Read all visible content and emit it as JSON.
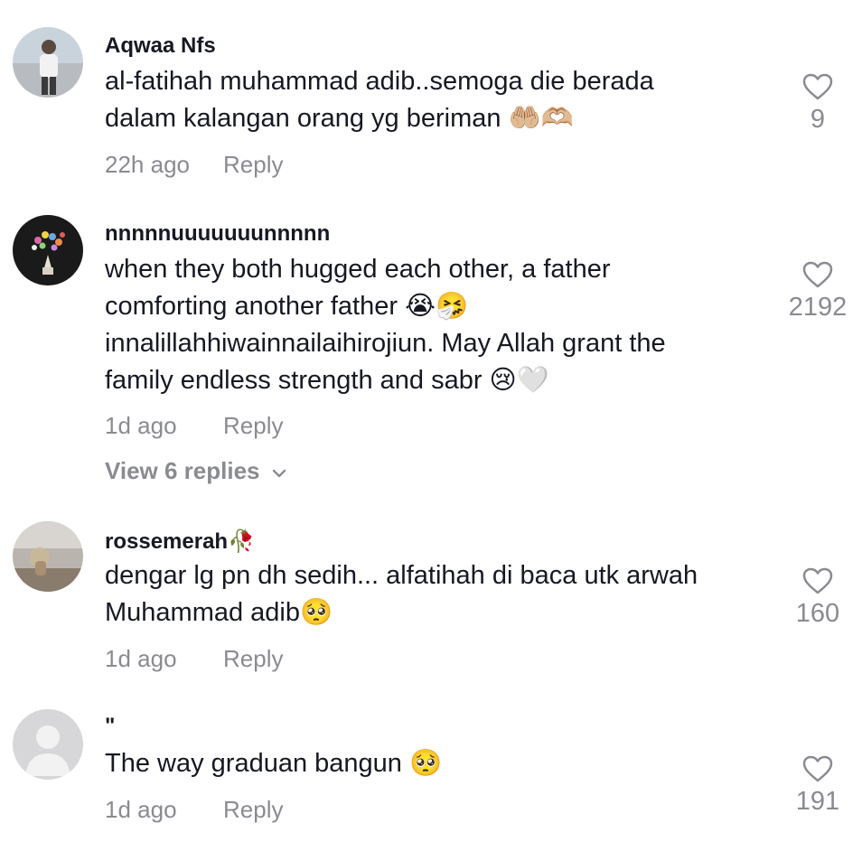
{
  "comments": [
    {
      "username": "Aqwaa Nfs",
      "lines": [
        "al-fatihah muhammad adib..semoga die berada",
        "dalam kalangan orang yg beriman 🤲🏼🫶🏼"
      ],
      "time": "22h ago",
      "reply_label": "Reply",
      "likes": "9"
    },
    {
      "username": "nnnnnuuuuuuunnnnn",
      "lines": [
        "when they both hugged each other, a father",
        "comforting another father 😭🤧",
        "innalillahhiwainnailaihirojiun. May Allah grant the",
        "family endless strength and sabr 😢🤍"
      ],
      "time": "1d ago",
      "reply_label": "Reply",
      "view_replies": "View 6 replies",
      "likes": "2192"
    },
    {
      "username": "rossemerah🥀",
      "lines": [
        "dengar lg pn dh sedih... alfatihah di baca utk arwah",
        "Muhammad adib🥺"
      ],
      "time": "1d ago",
      "reply_label": "Reply",
      "likes": "160"
    },
    {
      "username": "\"",
      "lines": [
        "The way graduan bangun 🥺"
      ],
      "time": "1d ago",
      "reply_label": "Reply",
      "likes": "191"
    }
  ],
  "icons": {
    "like": "heart-outline-icon",
    "expand": "chevron-down-icon"
  },
  "colors": {
    "text": "#161823",
    "muted": "#8a8b91",
    "background": "#ffffff"
  }
}
